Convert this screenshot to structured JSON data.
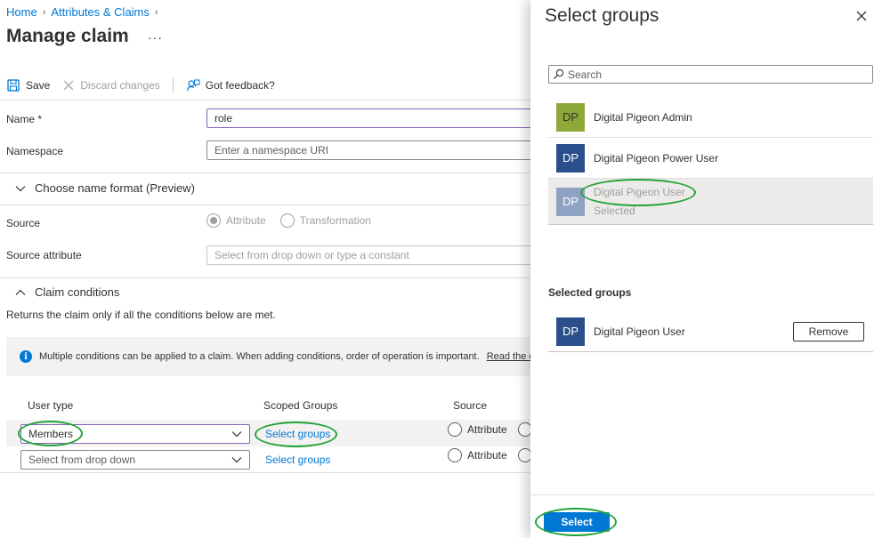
{
  "breadcrumb": {
    "home": "Home",
    "attributes": "Attributes & Claims"
  },
  "page": {
    "title": "Manage claim",
    "more": "···"
  },
  "toolbar": {
    "save": "Save",
    "discard": "Discard changes",
    "feedback": "Got feedback?"
  },
  "form": {
    "name_label": "Name *",
    "name_value": "role",
    "namespace_label": "Namespace",
    "namespace_placeholder": "Enter a namespace URI",
    "name_format_section": "Choose name format (Preview)",
    "source_label": "Source",
    "source_options": [
      "Attribute",
      "Transformation"
    ],
    "source_selected": "Attribute",
    "source_attribute_label": "Source attribute",
    "source_attribute_placeholder": "Select from drop down or type a constant"
  },
  "conditions": {
    "section": "Claim conditions",
    "description": "Returns the claim only if all the conditions below are met.",
    "info_text": "Multiple conditions can be applied to a claim.  When adding conditions, order of operation is important.",
    "info_link": "Read the d",
    "columns": [
      "User type",
      "Scoped Groups",
      "Source"
    ],
    "rows": [
      {
        "user_type": "Members",
        "scoped_groups": "Select groups",
        "source": "Attribute"
      },
      {
        "user_type": "Select from drop down",
        "scoped_groups": "Select groups",
        "source": "Attribute"
      }
    ]
  },
  "blade": {
    "title": "Select groups",
    "search_placeholder": "Search",
    "groups": [
      {
        "initials": "DP",
        "name": "Digital Pigeon Admin",
        "color": "#8fa83a"
      },
      {
        "initials": "DP",
        "name": "Digital Pigeon Power User",
        "color": "#2b4f8a"
      },
      {
        "initials": "DP",
        "name": "Digital Pigeon User",
        "status": "Selected",
        "color": "#8fa2c4"
      }
    ],
    "selected_heading": "Selected groups",
    "selected_groups": [
      {
        "initials": "DP",
        "name": "Digital Pigeon User",
        "action": "Remove",
        "color": "#2b4f8a"
      }
    ],
    "select_button": "Select"
  },
  "colors": {
    "accent": "#0078d4",
    "annotation": "#22a33a"
  }
}
